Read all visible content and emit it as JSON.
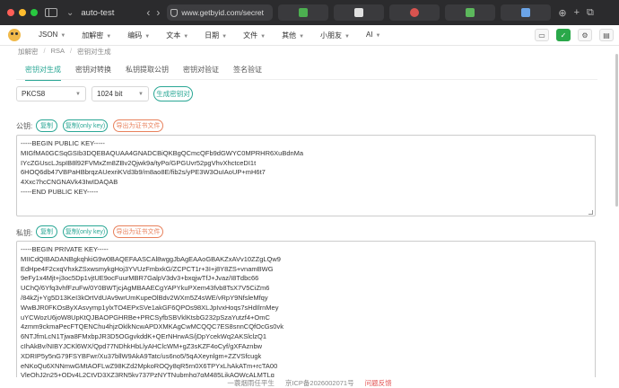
{
  "browser": {
    "active_tab": "auto-test",
    "url": "www.getbyid.com/secret",
    "colors": {
      "close": "#ff5f57",
      "minimize": "#febc2e",
      "maximize": "#28c840"
    },
    "tab_favicons": [
      "#4caf50",
      "#e0e0e0",
      "#d9534f",
      "#5cb85c",
      "#6ba4e8",
      "#9c7be0",
      "#888888"
    ]
  },
  "menu": {
    "items": [
      "JSON",
      "加解密",
      "编码",
      "文本",
      "日期",
      "文件",
      "其他",
      "小朋友",
      "AI"
    ]
  },
  "breadcrumb": [
    "加解密",
    "RSA",
    "密钥对生成"
  ],
  "tabs": [
    "密钥对生成",
    "密钥对转换",
    "私钥提取公钥",
    "密钥对验证",
    "签名验证"
  ],
  "controls": {
    "format": "PKCS8",
    "size": "1024 bit",
    "generate": "生成密钥对"
  },
  "public_key": {
    "label": "公钥:",
    "copy": "复制",
    "copy_only": "复制(only key)",
    "export": "导出为证书文件",
    "text": "-----BEGIN PUBLIC KEY-----\nMIGfMA0GCSqGSIb3DQEBAQUAA4GNADCBiQKBgQCmcQFb9dGWYC0MPRHR6XuBdnMa\nIYcZGUscLJspIB8l92FVMxZm8ZBv2Qjwk9a/tyPo/GPGUvr52pgVhvXhctceDI1t\n6HOQ6db47VBPaHBbrqzAUexriKVd3b9/m8ao8E/fib2s/yPE3W3OuIAoUP+mH6t7\n4Xxc7hcCNGNAVk43IwIDAQAB\n-----END PUBLIC KEY-----"
  },
  "private_key": {
    "label": "私钥:",
    "copy": "复制",
    "copy_only": "复制(only key)",
    "export": "导出为证书文件",
    "text": "-----BEGIN PRIVATE KEY-----\nMIICdQIBADANBgkqhkiG9w0BAQEFAASCAl8wggJbAgEAAoGBAKZxAVv10ZZgLQw9\nEdHpe4F2cxqVhxkZSxwsmykgHoj3YVUzFmbxkG/ZCPCT1r+3I+j8Y8ZS+vnamBWG\n9eFy1x4Mjt+j3oc5Dp1vjtUE9ocFuurMBR7GalpV3dv3+bxqjwTfJ+Jvaz/I8Tdbc66\nUChQ/6Yfq3vhfFzuFw/0Y0BWTjcjAgMBAAECgYAPYkuPXem43fvb8TsX7V5CiZm6\n/84kZj+Yg5D13KeI3kOrtVdUAv9wrUmKupeOlBdv2WXm5Z4sWE/vRpY9NfsleMfqy\nWwBJR0FKOsByXAsvymp1ylxTO4EPxSVe1akGF6QPOs98XLJpIvxHoqs7sHdIlrnMey\nuYCWozU6joW8UpKtQJBAOPGHRBe+PRCSyfbSBVklKtsbG232pSzaYutzf4+OmC\n4zmm9ckmaPecFTQENChu4hjzOklkNcwAPDXMKAgCwMCQQC7ES8snnCQfOcGs0vk\n6NTJfmLcN1Tjwa8FMxbpJR3D5OGgvkddK+QErNHrwAS/jDpYcekWq2AKSlclzQ1\ncIhAkBv/NIBYJCKl6WX/Qpd77NDhkHbLlyAHClcWM+gZ3sKZF4oCyf/gXFAznbw\nXDRIP5y5nG79FSYBFwr/Xu37bllW9AkA9Tatc/us6no5/5qAXeynlgm+ZZVSfcugk\neNKoQu6XNNmwGMtAOFLwZ98KZd2MpkoROQy8qR5rn0X6TPYxLhAkATm+rcTA00\nVleQhJ2n25+QDv4L2CtVD3XZ3RN5kv737PzNYTNubmhq7gM485LjkAOWcALMTLq"
  },
  "footer": {
    "motto": "一蓑烟雨任平生",
    "icp": "京ICP备2026002071号",
    "feedback": "问题反馈"
  }
}
